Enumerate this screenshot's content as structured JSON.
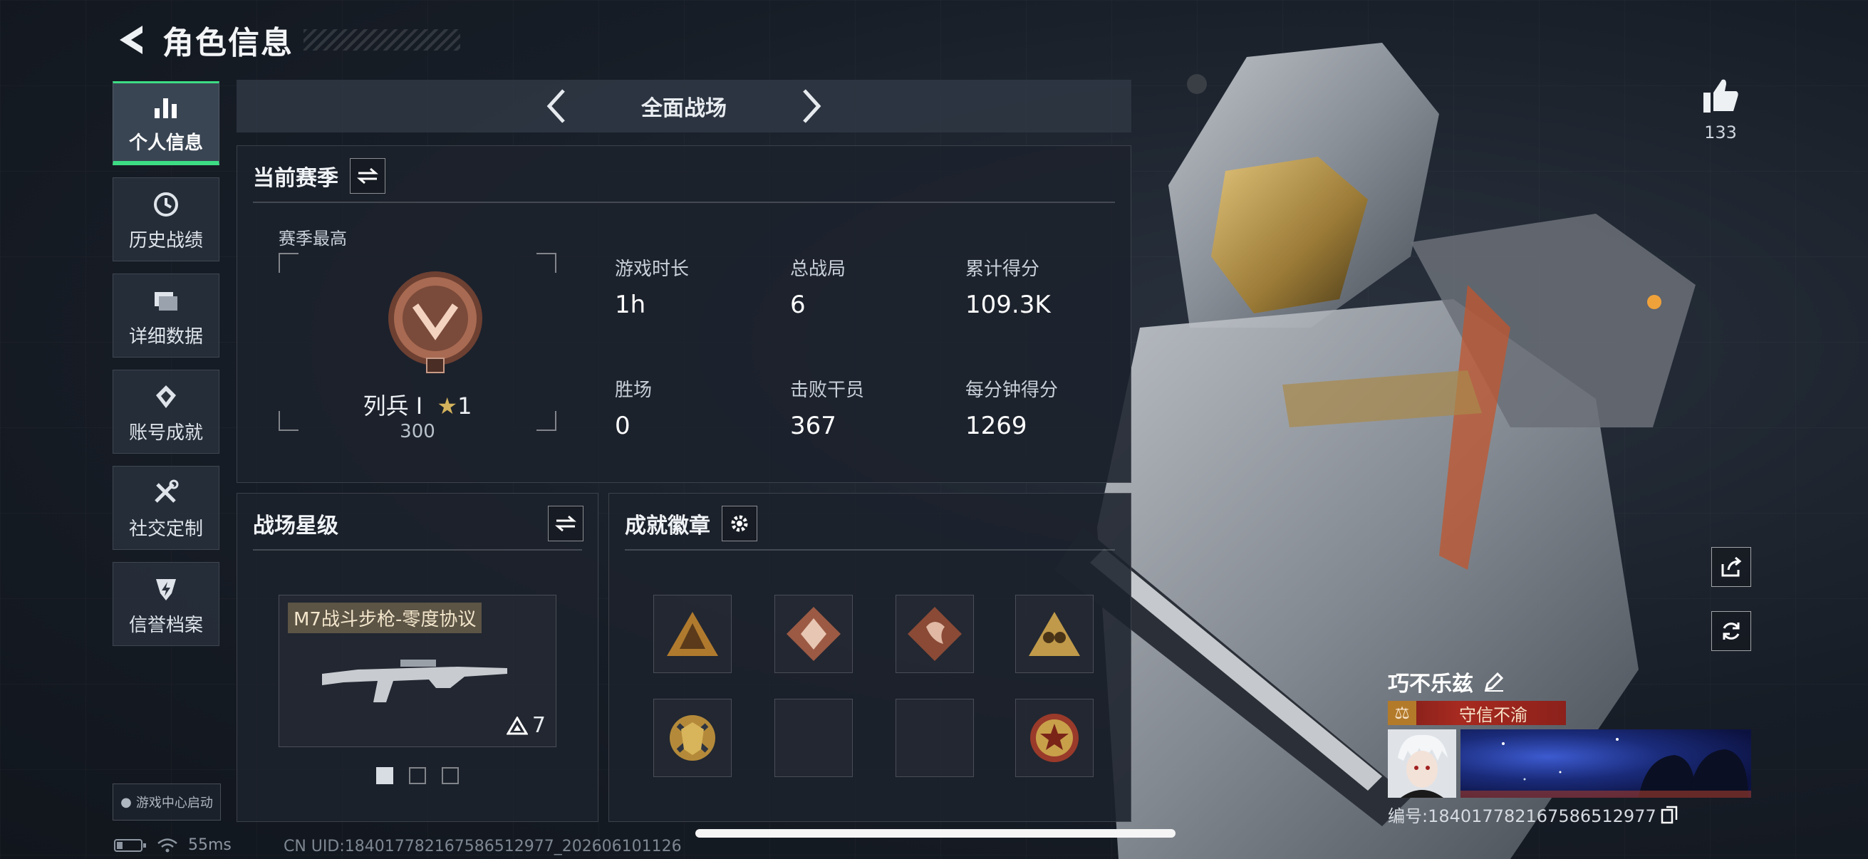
{
  "header": {
    "title": "角色信息"
  },
  "sidebar": {
    "items": [
      {
        "label": "个人信息",
        "icon": "bar-chart-icon",
        "active": true
      },
      {
        "label": "历史战绩",
        "icon": "history-clock-icon"
      },
      {
        "label": "详细数据",
        "icon": "folder-icon"
      },
      {
        "label": "账号成就",
        "icon": "achievement-icon"
      },
      {
        "label": "社交定制",
        "icon": "tools-icon"
      },
      {
        "label": "信誉档案",
        "icon": "shield-badge-icon"
      }
    ],
    "launch_label": "游戏中心启动"
  },
  "mode": {
    "label": "全面战场"
  },
  "season": {
    "title": "当前赛季",
    "best_label": "赛季最高",
    "rank_name": "列兵 Ⅰ",
    "stars": "1",
    "points": "300",
    "stats": [
      {
        "label": "游戏时长",
        "value": "1h"
      },
      {
        "label": "总战局",
        "value": "6"
      },
      {
        "label": "累计得分",
        "value": "109.3K"
      },
      {
        "label": "胜场",
        "value": "0"
      },
      {
        "label": "击败干员",
        "value": "367"
      },
      {
        "label": "每分钟得分",
        "value": "1269"
      }
    ]
  },
  "star_level": {
    "title": "战场星级",
    "weapon_name": "M7战斗步枪-零度协议",
    "weapon_level": "7",
    "page_count": 3,
    "active_page": 0
  },
  "medals": {
    "title": "成就徽章",
    "slots": [
      {
        "icon": "triangle-medal-icon",
        "filled": true
      },
      {
        "icon": "wolf-diamond-medal-icon",
        "filled": true
      },
      {
        "icon": "dragon-diamond-medal-icon",
        "filled": true
      },
      {
        "icon": "soldiers-triangle-medal-icon",
        "filled": true
      },
      {
        "icon": "crossed-shield-medal-icon",
        "filled": true
      },
      {
        "icon": "empty-slot",
        "filled": false
      },
      {
        "icon": "empty-slot",
        "filled": false
      },
      {
        "icon": "star-round-medal-icon",
        "filled": true
      }
    ]
  },
  "likes": {
    "count": "133"
  },
  "player": {
    "name": "巧不乐兹",
    "title": "守信不渝",
    "id_text": "编号:18401778216758651297​7"
  },
  "status": {
    "ping": "55ms",
    "uid": "CN UID:18401778216758651297​7_202606101126"
  },
  "colors": {
    "accent": "#3ddc84",
    "title_red": "#a72a20",
    "medal_bronze": "#b0694a"
  }
}
